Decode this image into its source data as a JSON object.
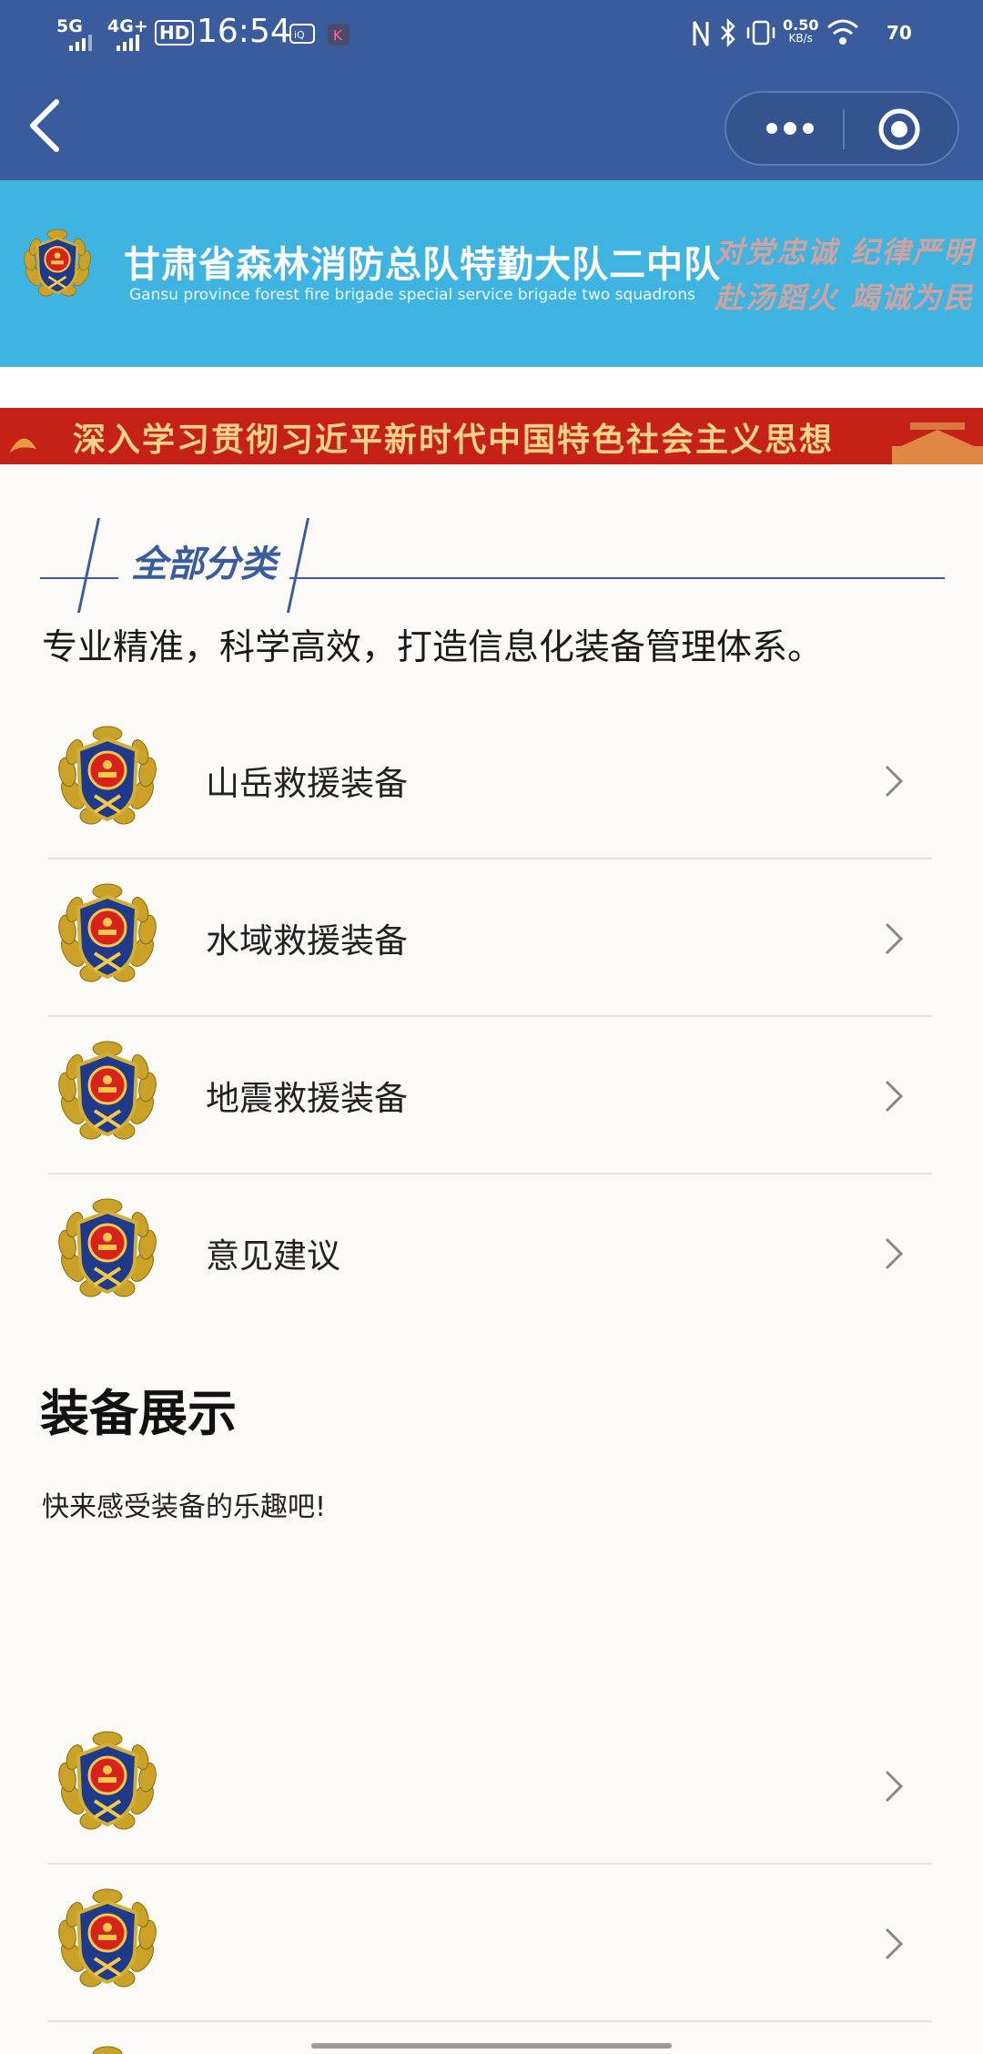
{
  "status_bar": {
    "network_1": "5G",
    "network_2": "4G+",
    "hd_label": "HD",
    "time": "16:54",
    "speed_value": "0.50",
    "speed_unit": "KB/s",
    "battery": "70"
  },
  "header": {
    "org_name": "甘肃省森林消防总队特勤大队二中队",
    "org_name_en": "Gansu province forest fire brigade special service brigade two squadrons",
    "slogan_line1": "对党忠诚 纪律严明",
    "slogan_line2": "赴汤蹈火 竭诚为民"
  },
  "red_banner": {
    "text": "深入学习贯彻习近平新时代中国特色社会主义思想"
  },
  "categories": {
    "title": "全部分类",
    "tagline": "专业精准，科学高效，打造信息化装备管理体系。",
    "items": [
      {
        "label": "山岳救援装备"
      },
      {
        "label": "水域救援装备"
      },
      {
        "label": "地震救援装备"
      },
      {
        "label": "意见建议"
      }
    ]
  },
  "equipment": {
    "title": "装备展示",
    "subtitle": "快来感受装备的乐趣吧!",
    "items": [
      {
        "label": ""
      },
      {
        "label": ""
      },
      {
        "label": ""
      }
    ]
  },
  "colors": {
    "nav_blue": "#3b5c9c",
    "banner_sky": "#40b4e0",
    "red_banner": "#c62117"
  }
}
